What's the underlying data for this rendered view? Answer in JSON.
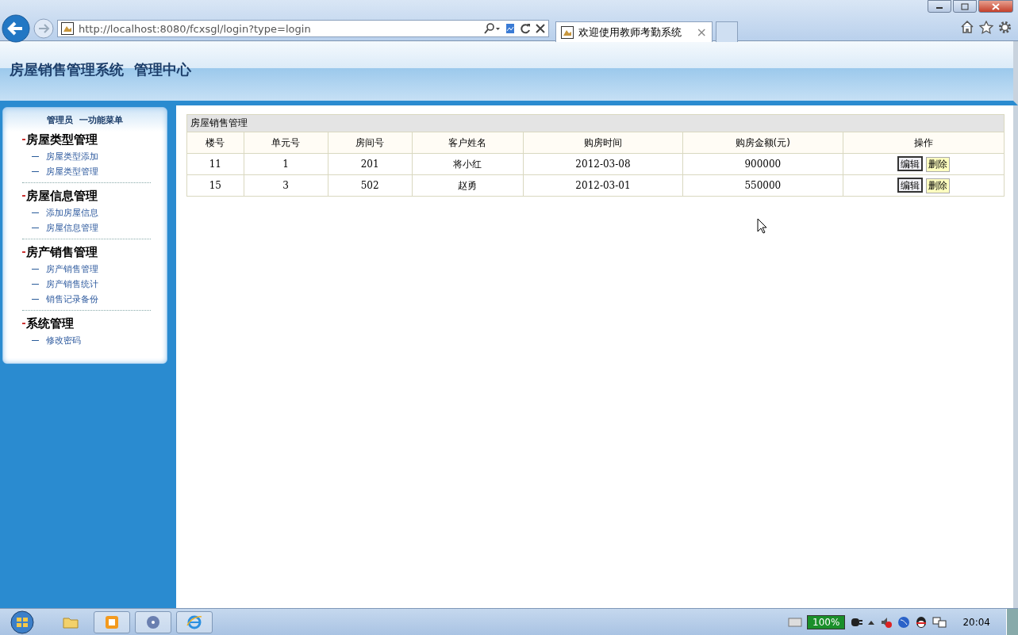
{
  "browser": {
    "address": "http://localhost:8080/fcxsgl/login?type=login",
    "tab_title": "欢迎使用教师考勤系统",
    "tab_close": "×"
  },
  "header": {
    "title": "房屋销售管理系统  管理中心"
  },
  "sidebar": {
    "heading": "管理员  一功能菜单",
    "groups": [
      {
        "title": "房屋类型管理",
        "items": [
          "房屋类型添加",
          "房屋类型管理"
        ]
      },
      {
        "title": "房屋信息管理",
        "items": [
          "添加房屋信息",
          "房屋信息管理"
        ]
      },
      {
        "title": "房产销售管理",
        "items": [
          "房产销售管理",
          "房产销售统计",
          "销售记录备份"
        ]
      },
      {
        "title": "系统管理",
        "items": [
          "修改密码"
        ]
      }
    ]
  },
  "table": {
    "caption": "房屋销售管理",
    "columns": [
      "楼号",
      "单元号",
      "房间号",
      "客户姓名",
      "购房时间",
      "购房金额(元)",
      "操作"
    ],
    "rows": [
      {
        "cells": [
          "11",
          "1",
          "201",
          "将小红",
          "2012-03-08",
          "900000"
        ],
        "actions": [
          {
            "label": "编辑",
            "kind": "edit"
          },
          {
            "label": "删除",
            "kind": "delete"
          }
        ]
      },
      {
        "cells": [
          "15",
          "3",
          "502",
          "赵勇",
          "2012-03-01",
          "550000"
        ],
        "actions": [
          {
            "label": "编辑",
            "kind": "edit"
          },
          {
            "label": "删除",
            "kind": "delete"
          }
        ]
      }
    ]
  },
  "taskbar": {
    "battery": "100%",
    "clock": "20:04"
  }
}
